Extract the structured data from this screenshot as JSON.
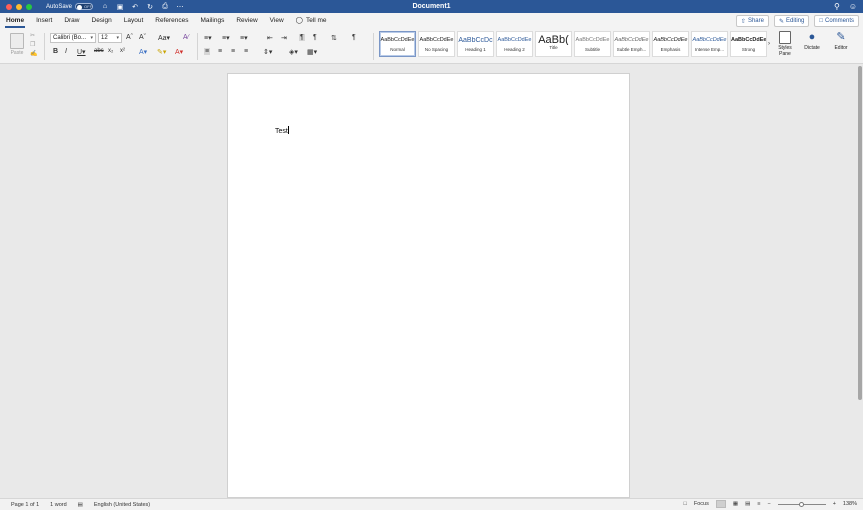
{
  "titlebar": {
    "autosave_label": "AutoSave",
    "autosave_state": "OFF",
    "document_title": "Document1"
  },
  "tabs": [
    "Home",
    "Insert",
    "Draw",
    "Design",
    "Layout",
    "References",
    "Mailings",
    "Review",
    "View"
  ],
  "tell_me": "Tell me",
  "actions": {
    "share": "Share",
    "editing": "Editing",
    "comments": "Comments"
  },
  "clipboard": {
    "paste_label": "Paste"
  },
  "font": {
    "name": "Calibri (Bo...",
    "size": "12"
  },
  "styles": [
    {
      "sample": "AaBbCcDdEe",
      "name": "Normal"
    },
    {
      "sample": "AaBbCcDdEe",
      "name": "No Spacing"
    },
    {
      "sample": "AaBbCcDc",
      "name": "Heading 1"
    },
    {
      "sample": "AaBbCcDdEe",
      "name": "Heading 2"
    },
    {
      "sample": "AaBb(",
      "name": "Title"
    },
    {
      "sample": "AaBbCcDdEe",
      "name": "Subtitle"
    },
    {
      "sample": "AaBbCcDdEe",
      "name": "Subtle Emph..."
    },
    {
      "sample": "AaBbCcDdEe",
      "name": "Emphasis"
    },
    {
      "sample": "AaBbCcDdEe",
      "name": "Intense Emp..."
    },
    {
      "sample": "AaBbCcDdEe",
      "name": "Strong"
    }
  ],
  "ribbon_buttons": {
    "styles_pane": "Styles Pane",
    "dictate": "Dictate",
    "editor": "Editor"
  },
  "document": {
    "body_text": "Test"
  },
  "statusbar": {
    "page": "Page 1 of 1",
    "words": "1 word",
    "language": "English (United States)",
    "focus": "Focus",
    "zoom": "138%",
    "zoom_level": 0.5
  },
  "colors": {
    "titlebar": "#2b5797",
    "accent": "#2b5797"
  }
}
